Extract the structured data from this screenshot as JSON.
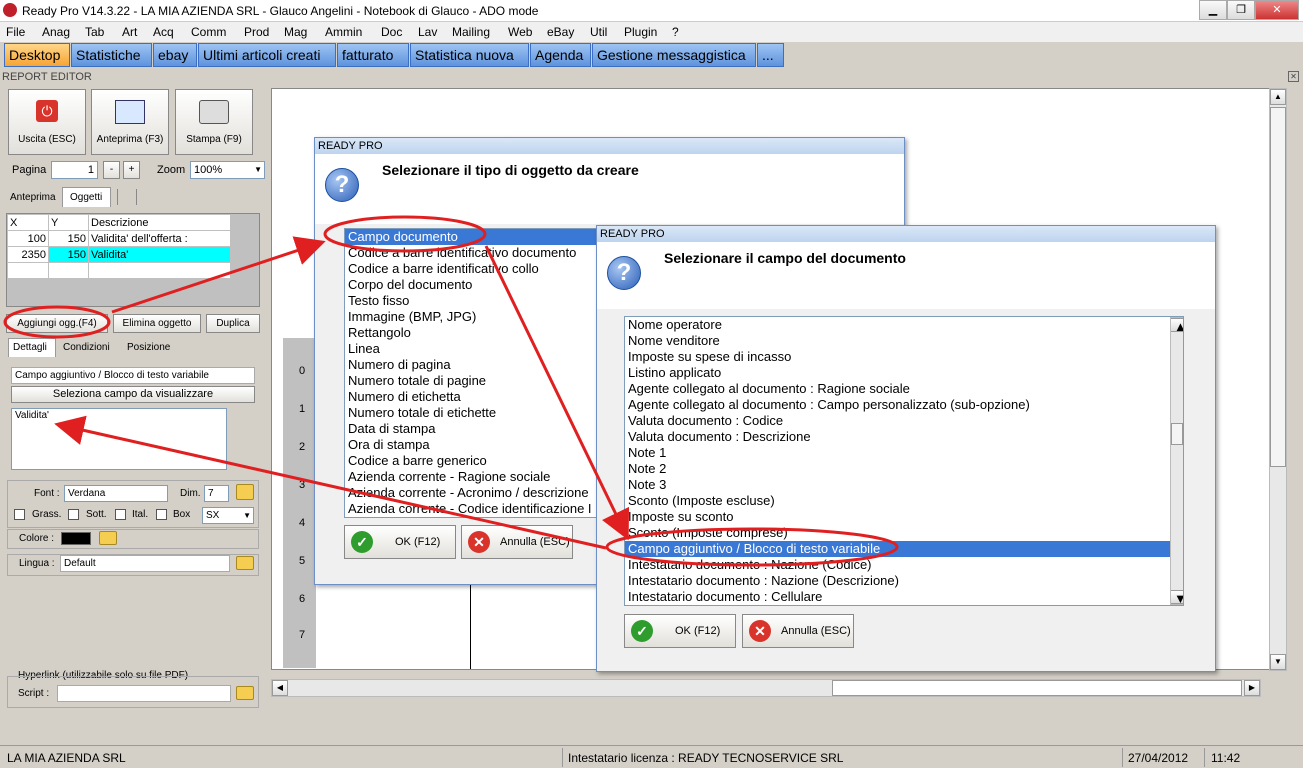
{
  "window": {
    "title": "Ready Pro V14.3.22 - LA MIA AZIENDA SRL - Glauco Angelini - Notebook di Glauco - ADO mode",
    "min": "▁",
    "max": "❐",
    "close": "✕"
  },
  "menu": [
    "File",
    "Anag",
    "Tab",
    "Art",
    "Acq",
    "Comm",
    "Prod",
    "Mag",
    "Ammin",
    "Doc",
    "Lav",
    "Mailing",
    "Web",
    "eBay",
    "Util",
    "Plugin",
    "?"
  ],
  "tabs": [
    "Desktop",
    "Statistiche",
    "ebay",
    "Ultimi articoli creati",
    "fatturato",
    "Statistica nuova",
    "Agenda",
    "Gestione messaggistica",
    "..."
  ],
  "section_title": "REPORT EDITOR",
  "toolbar": {
    "exit": "Uscita (ESC)",
    "preview": "Anteprima (F3)",
    "print": "Stampa (F9)"
  },
  "page": {
    "label": "Pagina",
    "value": "1",
    "minus": "-",
    "plus": "+",
    "zoom_label": "Zoom",
    "zoom_value": "100%"
  },
  "left_tabs": [
    "Anteprima",
    "Oggetti"
  ],
  "objects": {
    "headers": [
      "X",
      "Y",
      "Descrizione"
    ],
    "rows": [
      [
        "100",
        "150",
        "Validita' dell'offerta :"
      ],
      [
        "2350",
        "150",
        "Validita'"
      ]
    ]
  },
  "obj_buttons": {
    "add": "Aggiungi ogg.(F4)",
    "delete": "Elimina oggetto",
    "duplicate": "Duplica"
  },
  "detail_tabs": [
    "Dettagli",
    "Condizioni",
    "Posizione"
  ],
  "details": {
    "type": "Campo aggiuntivo / Blocco di testo variabile",
    "select_field": "Seleziona campo da visualizzare",
    "text": "Validita'"
  },
  "font": {
    "label": "Font :",
    "value": "Verdana",
    "dim_label": "Dim.",
    "dim_value": "7",
    "bold": "Grass.",
    "underline": "Sott.",
    "italic": "Ital.",
    "box": "Box",
    "align": "SX"
  },
  "color": {
    "label": "Colore :",
    "value": "#000000"
  },
  "language": {
    "label": "Lingua :",
    "value": "Default"
  },
  "hyperlink": {
    "label": "Hyperlink (utilizzabile solo su file PDF)",
    "script_label": "Script :"
  },
  "ruler": [
    "0",
    "1",
    "2",
    "3",
    "4",
    "5",
    "6",
    "7"
  ],
  "dialog1": {
    "header": "READY PRO",
    "title": "Selezionare il tipo di oggetto da creare",
    "items": [
      "Campo documento",
      "Codice a barre identificativo documento",
      "Codice a barre identificativo collo",
      "Corpo del documento",
      "Testo fisso",
      "Immagine (BMP, JPG)",
      "Rettangolo",
      "Linea",
      "Numero di pagina",
      "Numero totale di pagine",
      "Numero di etichetta",
      "Numero totale di etichette",
      "Data di stampa",
      "Ora di stampa",
      "Codice a barre generico",
      "Azienda corrente - Ragione sociale",
      "Azienda corrente - Acronimo / descrizione",
      "Azienda corrente - Codice identificazione I"
    ],
    "ok": "OK (F12)",
    "cancel": "Annulla (ESC)"
  },
  "dialog2": {
    "header": "READY PRO",
    "title": "Selezionare il campo del documento",
    "items": [
      "Nome operatore",
      "Nome venditore",
      "Imposte su spese di incasso",
      "Listino applicato",
      "Agente collegato al documento : Ragione sociale",
      "Agente collegato al documento : Campo personalizzato (sub-opzione)",
      "Valuta documento : Codice",
      "Valuta documento : Descrizione",
      "Note 1",
      "Note 2",
      "Note 3",
      "Sconto (Imposte escluse)",
      "Imposte su sconto",
      "Sconto (Imposte comprese)",
      "Campo aggiuntivo / Blocco di testo variabile",
      "Intestatario documento : Nazione (Codice)",
      "Intestatario documento : Nazione (Descrizione)",
      "Intestatario documento : Cellulare"
    ],
    "ok": "OK (F12)",
    "cancel": "Annulla (ESC)"
  },
  "status": {
    "company": "LA MIA AZIENDA SRL",
    "license": "Intestatario licenza : READY TECNOSERVICE SRL",
    "date": "27/04/2012",
    "time": "11:42"
  },
  "colors": {
    "accent": "#3a78d6",
    "annotation": "#e02020",
    "selected_row": "#00ffff"
  }
}
